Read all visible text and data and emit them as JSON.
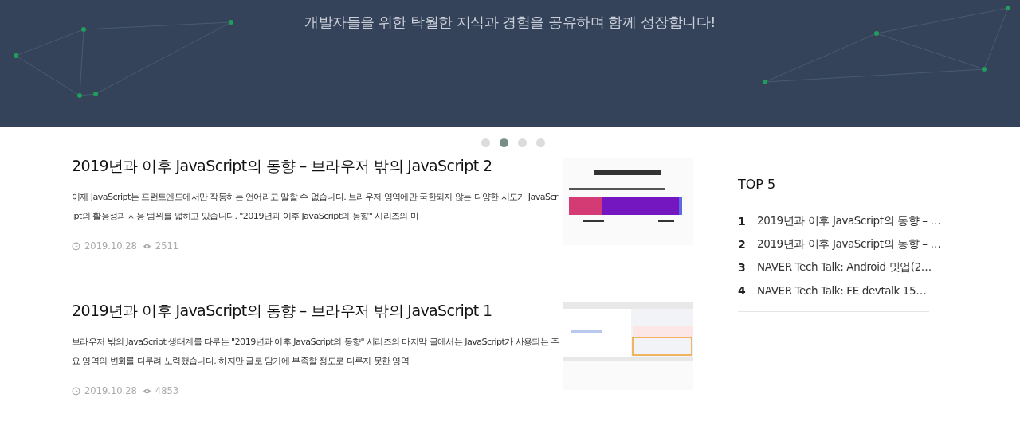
{
  "banner": {
    "tagline": "개발자들을 위한 탁월한 지식과 경험을 공유하며 함께 성장합니다!"
  },
  "slider_dots": [
    {
      "selected": false
    },
    {
      "selected": true
    },
    {
      "selected": false
    },
    {
      "selected": false
    }
  ],
  "posts": [
    {
      "title": "2019년과 이후 JavaScript의 동향 – 브라우저 밖의 JavaScript 2",
      "excerpt": "이제 JavaScript는 프런트엔드에서만 작동하는 언어라고 말할 수 없습니다. 브라우저 영역에만 국한되지 않는 다양한 시도가 JavaScript의 활용성과 사용 범위를 넓히고 있습니다. \"2019년과 이후 JavaScript의 동향\" 시리즈의 마",
      "date": "2019.10.28",
      "views": "2511"
    },
    {
      "title": "2019년과 이후 JavaScript의 동향 – 브라우저 밖의 JavaScript 1",
      "excerpt": "브라우저 밖의 JavaScript 생태계를 다루는 \"2019년과 이후 JavaScript의 동향\" 시리즈의 마지막 글에서는 JavaScript가 사용되는 주요 영역의 변화를 다루려 노력했습니다. 하지만 글로 담기에 부족할 정도로 다루지 못한 영역",
      "date": "2019.10.28",
      "views": "4853"
    }
  ],
  "sidebar": {
    "title": "TOP 5",
    "items": [
      {
        "rank": "1",
        "title": "2019년과 이후 JavaScript의 동향 – …"
      },
      {
        "rank": "2",
        "title": "2019년과 이후 JavaScript의 동향 – …"
      },
      {
        "rank": "3",
        "title": "NAVER Tech Talk: Android 밋업(2…"
      },
      {
        "rank": "4",
        "title": "NAVER Tech Talk: FE devtalk 15…"
      }
    ]
  }
}
